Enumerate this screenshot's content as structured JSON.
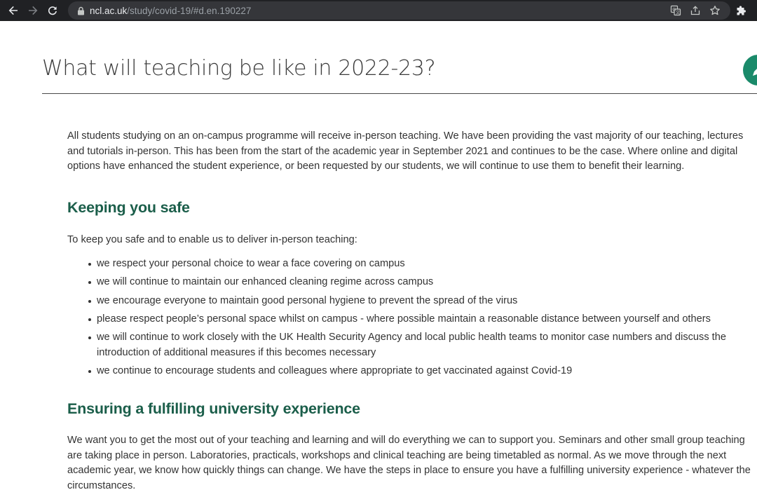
{
  "browser": {
    "url_host": "ncl.ac.uk",
    "url_path": "/study/covid-19/#d.en.190227",
    "icons": {
      "back": "arrow-left-icon",
      "forward": "arrow-right-icon",
      "reload": "reload-icon",
      "lock": "lock-icon",
      "translate": "translate-icon",
      "share": "share-icon",
      "bookmark": "star-icon",
      "extensions": "puzzle-icon"
    }
  },
  "page": {
    "title": "What will teaching be like in 2022-23?",
    "intro": "All students studying on an on-campus programme will receive in-person teaching. We have been providing the vast majority of our teaching, lectures and tutorials in-person. This has been from the start of the academic year in September 2021 and continues to be the case. Where online and digital options have enhanced the student experience, or been requested by our students, we will continue to use them to benefit their learning.",
    "section1": {
      "heading": "Keeping you safe",
      "lead": "To keep you safe and to enable us to deliver in-person teaching:",
      "bullets": [
        "we respect your personal choice to wear a face covering on campus",
        "we will continue to maintain our enhanced cleaning regime across campus",
        "we encourage everyone to maintain good personal hygiene to prevent the spread of the virus",
        "please respect people’s personal space whilst on campus - where possible maintain a reasonable distance between yourself and others",
        "we will continue to work closely with the UK Health Security Agency and local public health teams to monitor case numbers and discuss the introduction of additional measures if this becomes necessary",
        "we continue to encourage students and colleagues where appropriate to get vaccinated against Covid-19"
      ]
    },
    "section2": {
      "heading": "Ensuring a fulfilling university experience",
      "body": "We want you to get the most out of your teaching and learning and will do everything we can to support you. Seminars and other small group teaching are taking place in person. Laboratories, practicals, workshops and clinical teaching are being timetabled as normal. As we move through the next academic year, we know how quickly things can change. We have the steps in place to ensure you have a fulfilling university experience - whatever the circumstances."
    },
    "colors": {
      "heading_green": "#1b5e4a",
      "fab_green": "#1a8a6a",
      "text": "#333333"
    }
  }
}
